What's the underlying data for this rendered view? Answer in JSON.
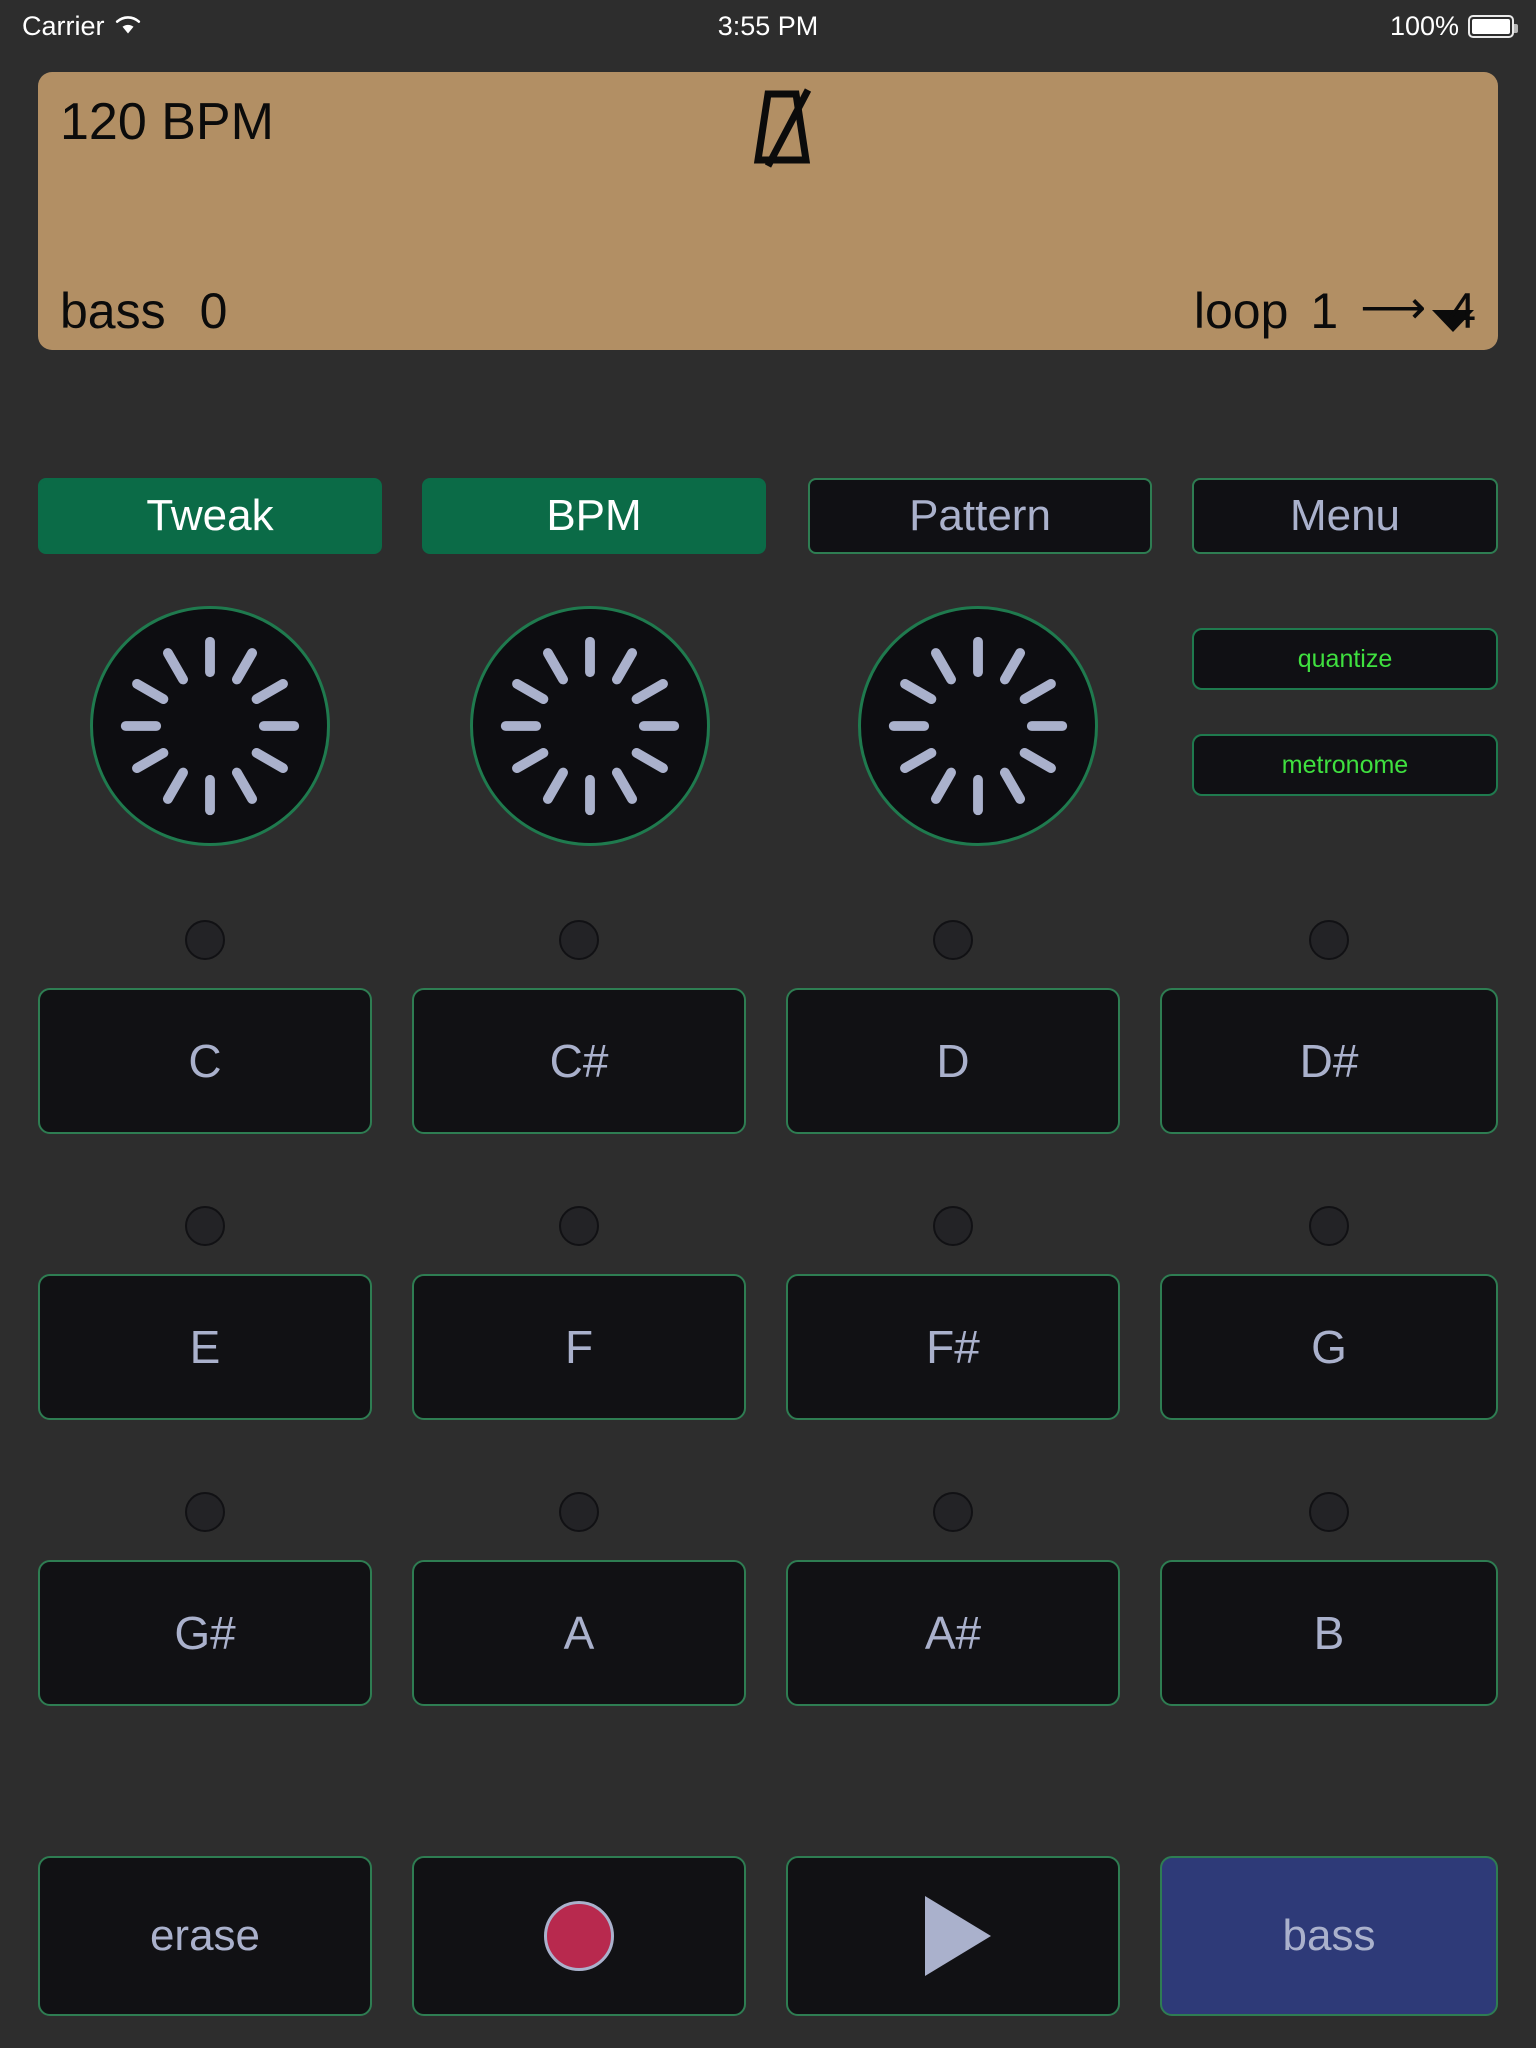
{
  "statusbar": {
    "carrier": "Carrier",
    "wifi_icon": "wifi-icon",
    "time": "3:55 PM",
    "battery_percent": "100%",
    "battery_icon": "battery-icon"
  },
  "display": {
    "bpm": "120 BPM",
    "metronome_icon": "metronome-icon",
    "caret_icon": "chevron-down-icon",
    "track_label": "bass",
    "track_value": "0",
    "loop_label": "loop",
    "loop_start": "1",
    "loop_arrow": "⟶",
    "loop_end": "4",
    "bg_color": "#B28F64",
    "text_color": "#0B0B0B"
  },
  "modes": [
    {
      "label": "Tweak",
      "active": true
    },
    {
      "label": "BPM",
      "active": true
    },
    {
      "label": "Pattern",
      "active": false
    },
    {
      "label": "Menu",
      "active": false
    }
  ],
  "knobs": [
    {
      "name": "knob-1",
      "ticks": 11
    },
    {
      "name": "knob-2",
      "ticks": 11
    },
    {
      "name": "knob-3",
      "ticks": 11
    }
  ],
  "toggles": [
    {
      "label": "quantize",
      "color": "#3FE03F"
    },
    {
      "label": "metronome",
      "color": "#3FE03F"
    }
  ],
  "notes": {
    "rows": [
      [
        "C",
        "C#",
        "D",
        "D#"
      ],
      [
        "E",
        "F",
        "F#",
        "G"
      ],
      [
        "G#",
        "A",
        "A#",
        "B"
      ]
    ]
  },
  "transport": {
    "erase_label": "erase",
    "record_icon": "record-icon",
    "play_icon": "play-icon",
    "instrument_label": "bass"
  },
  "colors": {
    "background": "#2D2D2D",
    "panel": "#B28F64",
    "accent_green": "#0B6B47",
    "border_green": "#2E7D52",
    "text_lavender": "#AAB1CC",
    "led_green": "#3FE03F",
    "record_red": "#B8294E",
    "instrument_blue": "#2E3A78"
  }
}
